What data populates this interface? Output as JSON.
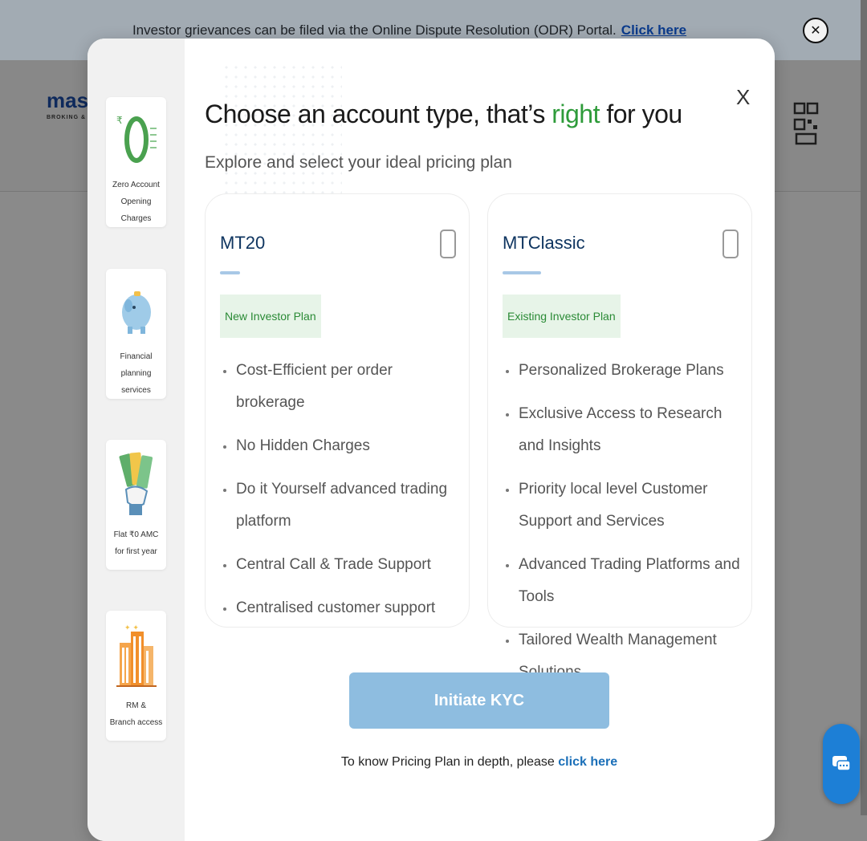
{
  "banner": {
    "text": "Investor grievances can be filed via the Online Dispute Resolution (ODR) Portal.",
    "link": "Click here",
    "close_icon": "close-circle-icon"
  },
  "background": {
    "logo_text": "maste",
    "logo_subtext": "BROKING & IN"
  },
  "modal": {
    "close_label": "X",
    "title_prefix": "Choose an account type, that’s ",
    "title_highlight": "right",
    "title_suffix": " for you",
    "subtitle": "Explore and select your ideal pricing plan",
    "highlight_color": "#2e9b3a",
    "sidebar": [
      {
        "icon": "zero-rupee-icon",
        "label_line1": "Zero Account",
        "label_line2": "Opening Charges"
      },
      {
        "icon": "piggy-bank-icon",
        "label_line1": "Financial",
        "label_line2": "planning services"
      },
      {
        "icon": "cash-in-hand-icon",
        "label_line1": "Flat ₹0 AMC",
        "label_line2": "for first year"
      },
      {
        "icon": "buildings-icon",
        "label_line1": "RM &",
        "label_line2": "Branch access"
      }
    ],
    "plans": [
      {
        "name": "MT20",
        "badge": "New Investor Plan",
        "features": [
          "Cost-Efficient per order brokerage",
          "No Hidden Charges",
          "Do it Yourself advanced trading platform",
          "Central Call & Trade Support",
          "Centralised customer support"
        ]
      },
      {
        "name": "MTClassic",
        "badge": "Existing Investor Plan",
        "features": [
          "Personalized Brokerage Plans",
          "Exclusive Access to Research and Insights",
          "Priority local level Customer Support and Services",
          "Advanced Trading Platforms and Tools",
          "Tailored Wealth Management Solutions"
        ]
      }
    ],
    "cta_label": "Initiate KYC",
    "footer_text": "To know Pricing Plan in depth, please",
    "footer_link": "click here"
  },
  "chat_icon": "chat-bubble-icon"
}
